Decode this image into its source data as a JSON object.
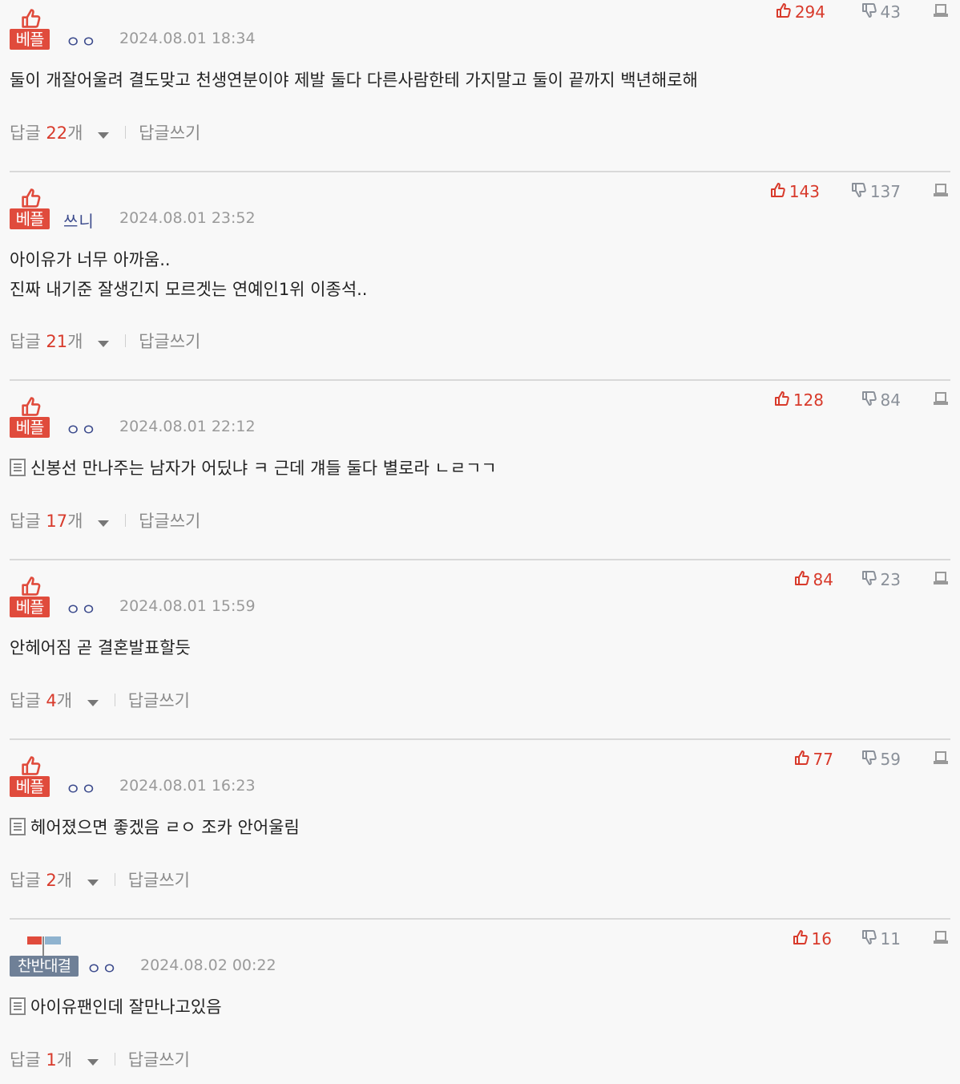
{
  "ui": {
    "reply_prefix": "답글 ",
    "reply_suffix": "개",
    "write_reply": "답글쓰기",
    "best_badge": "베플",
    "versus_badge": "찬반대결"
  },
  "comments": [
    {
      "badge": "best",
      "nick": "ㅇㅇ",
      "date": "2024.08.01 18:34",
      "up": "294",
      "down": "43",
      "has_doc_icon": false,
      "text": "둘이 개잘어울려 결도맞고 천생연분이야 제발 둘다 다른사람한테 가지말고 둘이 끝까지 백년해로해",
      "reply_count": "22"
    },
    {
      "badge": "best",
      "nick": "쓰니",
      "date": "2024.08.01 23:52",
      "up": "143",
      "down": "137",
      "has_doc_icon": false,
      "text": "아이유가 너무 아까움..\n진짜 내기준 잘생긴지 모르겟는 연예인1위 이종석..",
      "reply_count": "21"
    },
    {
      "badge": "best",
      "nick": "ㅇㅇ",
      "date": "2024.08.01 22:12",
      "up": "128",
      "down": "84",
      "has_doc_icon": true,
      "text": "신봉선 만나주는 남자가 어딨냐 ㅋ 근데 걔들 둘다 별로라 ㄴㄹㄱㄱ",
      "reply_count": "17"
    },
    {
      "badge": "best",
      "nick": "ㅇㅇ",
      "date": "2024.08.01 15:59",
      "up": "84",
      "down": "23",
      "has_doc_icon": false,
      "text": "안헤어짐 곧 결혼발표할듯",
      "reply_count": "4"
    },
    {
      "badge": "best",
      "nick": "ㅇㅇ",
      "date": "2024.08.01 16:23",
      "up": "77",
      "down": "59",
      "has_doc_icon": true,
      "text": "헤어졌으면 좋겠음 ㄹㅇ 조카 안어울림",
      "reply_count": "2"
    },
    {
      "badge": "versus",
      "nick": "ㅇㅇ",
      "date": "2024.08.02 00:22",
      "up": "16",
      "down": "11",
      "has_doc_icon": true,
      "text": "아이유팬인데 잘만나고있음",
      "reply_count": "1"
    }
  ],
  "colors": {
    "upvote": "#d83a2b",
    "best_badge": "#e04b3c",
    "versus_badge": "#6f8097",
    "nick": "#3b4a8c",
    "meta": "#9a9a9a"
  },
  "icons": {
    "best": "thumbs-up-icon",
    "versus": "flags-icon",
    "up": "thumbs-up-icon",
    "down": "thumbs-down-icon",
    "report": "report-icon",
    "doc": "document-icon",
    "caret": "caret-down-icon"
  }
}
